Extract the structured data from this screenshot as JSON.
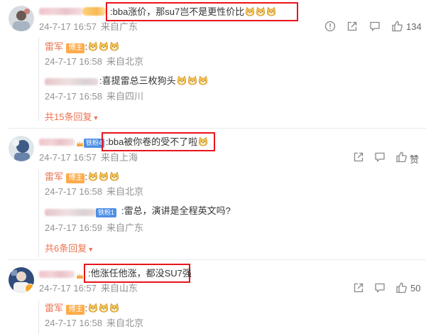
{
  "comment1": {
    "text": ":bba涨价，那su7岂不是更性价比",
    "time": "24-7-17 16:57",
    "location": "来自广东",
    "like_count": "134",
    "replies": [
      {
        "author": "雷军",
        "badge": "博主",
        "text": ":",
        "time": "24-7-17 16:58",
        "location": "来自北京"
      },
      {
        "author": "",
        "text": ":喜提雷总三枚狗头",
        "time": "24-7-17 16:58",
        "location": "来自四川"
      }
    ],
    "more_replies": "共15条回复"
  },
  "comment2": {
    "badge": "铁粉4",
    "text": ":bba被你卷的受不了啦",
    "time": "24-7-17 16:57",
    "location": "来自上海",
    "like_count": "",
    "replies": [
      {
        "author": "雷军",
        "badge": "博主",
        "text": ":",
        "time": "24-7-17 16:58",
        "location": "来自北京"
      },
      {
        "author": "",
        "badge": "铁粉1",
        "text": ":雷总，演讲是全程英文吗?",
        "time": "24-7-17 16:59",
        "location": "来自广东"
      }
    ],
    "more_replies": "共6条回复"
  },
  "comment3": {
    "text": ":他涨任他涨，都没SU7强",
    "time": "24-7-17 16:57",
    "location": "来自山东",
    "like_count": "50",
    "replies": [
      {
        "author": "雷军",
        "badge": "博主",
        "text": ":",
        "time": "24-7-17 16:58",
        "location": "来自北京"
      }
    ]
  },
  "icons": {
    "report": "report-icon",
    "share": "share-icon",
    "comment": "comment-icon",
    "like": "thumbs-up-icon",
    "emoji": "doge-emoji-icon",
    "expand": "caret-down-icon"
  },
  "colors": {
    "highlight_box": "#e8141b",
    "link": "#eb7350",
    "meta": "#939393",
    "badge_orange": "#ffab4a",
    "badge_blue": "#4f8fe4"
  }
}
